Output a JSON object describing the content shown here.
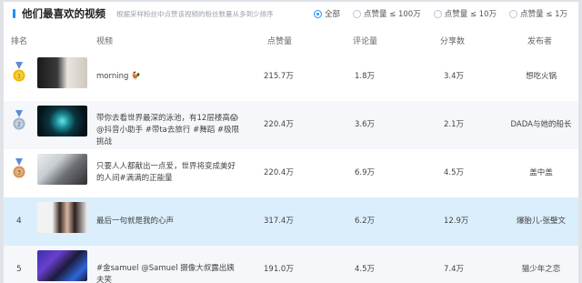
{
  "header": {
    "title": "他们最喜欢的视频",
    "subtitle": "根据采样粉丝中点赞该视频的粉丝数量从多到少排序",
    "filters": [
      {
        "label": "全部",
        "checked": true
      },
      {
        "label": "点赞量 ≤ 100万",
        "checked": false
      },
      {
        "label": "点赞量 ≤ 10万",
        "checked": false
      },
      {
        "label": "点赞量 ≤ 1万",
        "checked": false
      }
    ]
  },
  "columns": {
    "rank": "排名",
    "video": "视频",
    "likes": "点赞量",
    "comments": "评论量",
    "shares": "分享数",
    "author": "发布者"
  },
  "rows": [
    {
      "rank": "1",
      "medal": "gold",
      "title": "morning 🐓",
      "likes": "215.7万",
      "comments": "1.8万",
      "shares": "3.4万",
      "author": "想吃火锅"
    },
    {
      "rank": "2",
      "medal": "silver",
      "title": "带你去看世界最深的泳池，有12层楼高😱 @抖音小助手 #带ta去旅行 #舞蹈 #极限挑战",
      "likes": "220.4万",
      "comments": "3.6万",
      "shares": "2.1万",
      "author": "DADA与她的船长"
    },
    {
      "rank": "3",
      "medal": "bronze",
      "title": "只要人人都献出一点爱，世界将变成美好的人间#满满的正能量",
      "likes": "220.4万",
      "comments": "6.9万",
      "shares": "4.5万",
      "author": "盖中盖"
    },
    {
      "rank": "4",
      "medal": "",
      "title": "最后一句就是我的心声",
      "likes": "317.4万",
      "comments": "6.2万",
      "shares": "12.9万",
      "author": "爆胎儿-张璧文"
    },
    {
      "rank": "5",
      "medal": "",
      "title": "#金samuel @Samuel 摄像大叔露出姨夫笑",
      "likes": "191.0万",
      "comments": "4.5万",
      "shares": "7.4万",
      "author": "猫少年之恋"
    }
  ],
  "colors": {
    "accent": "#1e90ff",
    "gold": "#f2b705",
    "silver": "#9fb3c8",
    "bronze": "#d4935a",
    "highlight_row": "#dbeefb"
  }
}
